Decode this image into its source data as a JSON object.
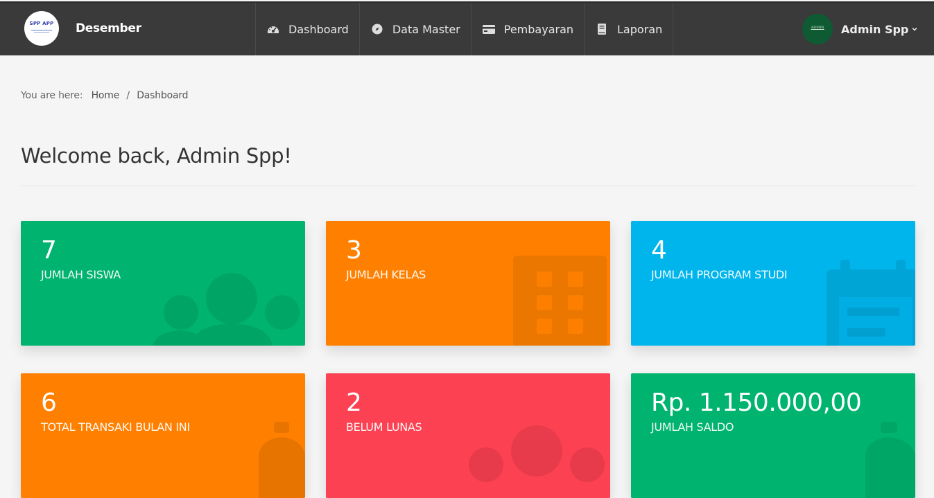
{
  "header": {
    "logo_text": "SPP APP",
    "brand": "Desember",
    "nav": [
      {
        "label": "Dashboard",
        "icon": "dashboard-gauge-icon"
      },
      {
        "label": "Data Master",
        "icon": "compass-icon"
      },
      {
        "label": "Pembayaran",
        "icon": "credit-card-icon"
      },
      {
        "label": "Laporan",
        "icon": "book-icon"
      }
    ],
    "user": {
      "avatar_text": "ADMIN",
      "name": "Admin Spp"
    }
  },
  "breadcrumb": {
    "prefix": "You are here:",
    "items": [
      "Home",
      "Dashboard"
    ],
    "separator": "/"
  },
  "page_title": "Welcome back, Admin Spp!",
  "cards": [
    {
      "value": "7",
      "label": "JUMLAH SISWA",
      "color": "#00b36e",
      "icon": "users-icon"
    },
    {
      "value": "3",
      "label": "JUMLAH KELAS",
      "color": "#ff8000",
      "icon": "building-icon"
    },
    {
      "value": "4",
      "label": "JUMLAH PROGRAM STUDI",
      "color": "#00b5ec",
      "icon": "calendar-icon"
    },
    {
      "value": "6",
      "label": "TOTAL TRANSAKI BULAN INI",
      "color": "#ff8000",
      "icon": "money-bag-icon"
    },
    {
      "value": "2",
      "label": "BELUM LUNAS",
      "color": "#fc4152",
      "icon": "users-icon"
    },
    {
      "value": "Rp. 1.150.000,00",
      "label": "JUMLAH SALDO",
      "color": "#00b36e",
      "icon": "money-bag-icon"
    }
  ],
  "colors": {
    "topbar": "#3a3a3a",
    "background": "#f5f5f5"
  }
}
